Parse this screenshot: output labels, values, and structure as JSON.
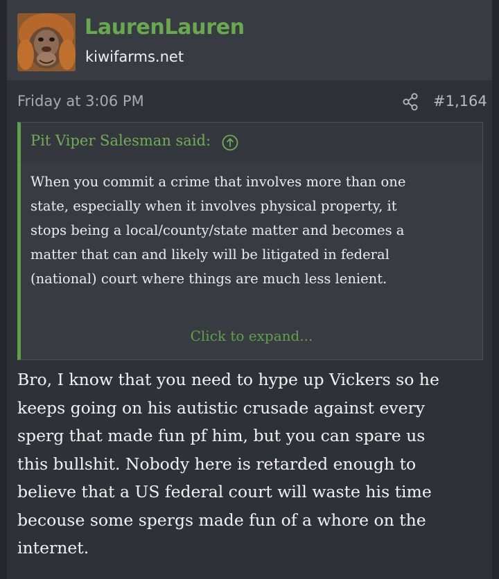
{
  "user": {
    "name": "LaurenLauren",
    "domain": "kiwifarms.net",
    "avatar_icon": "orangutan-avatar"
  },
  "post": {
    "date": "Friday at 3:06 PM",
    "number": "#1,164",
    "share_icon": "share-icon"
  },
  "quote": {
    "author_label": "Pit Viper Salesman said:",
    "jump_icon": "arrow-up-circle-icon",
    "lines": [
      "When you commit a crime that involves more than one",
      "state, especially when it involves physical property, it",
      "stops being a local/county/state matter and becomes a",
      "matter that can and likely will be litigated in federal",
      "(national) court where things are much less lenient."
    ],
    "expand_label": "Click to expand..."
  },
  "message": {
    "lines": [
      "Bro, I know that you need to hype up Vickers so he",
      "keeps going on his autistic crusade against every",
      "sperg that made fun pf him, but you can spare us",
      "this bullshit. Nobody here is retarded enough to",
      "believe that a US federal court will waste his time",
      "becouse some spergs made fun of a whore on the",
      "internet."
    ]
  },
  "colors": {
    "username": "#6aa84f",
    "quote_accent": "#5fa14b",
    "background": "#2e3137",
    "header": "#383c42"
  }
}
